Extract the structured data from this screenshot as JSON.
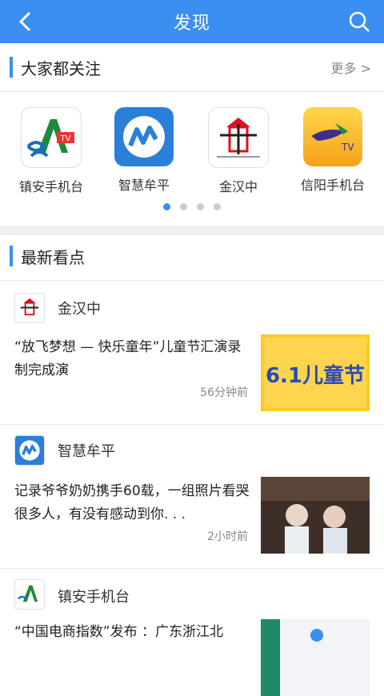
{
  "header": {
    "title": "发现"
  },
  "popular": {
    "title": "大家都关注",
    "more": "更多 >",
    "apps": [
      {
        "name": "镇安手机台"
      },
      {
        "name": "智慧牟平"
      },
      {
        "name": "金汉中"
      },
      {
        "name": "信阳手机台"
      }
    ],
    "page_count": 4,
    "active_page": 1
  },
  "latest": {
    "title": "最新看点",
    "items": [
      {
        "source": "金汉中",
        "headline": "“放飞梦想 — 快乐童年”儿童节汇演录制完成演",
        "time": "56分钟前",
        "thumb_text": "6.1儿童节"
      },
      {
        "source": "智慧牟平",
        "headline": "记录爷爷奶奶携手60载，一组照片看哭很多人，有没有感动到你. . .",
        "time": "2小时前"
      },
      {
        "source": "镇安手机台",
        "headline": "“中国电商指数”发布 ：广东浙江北"
      }
    ]
  },
  "icons": [
    "back-arrow-icon",
    "search-icon"
  ],
  "colors": {
    "accent": "#3a8ff0"
  }
}
